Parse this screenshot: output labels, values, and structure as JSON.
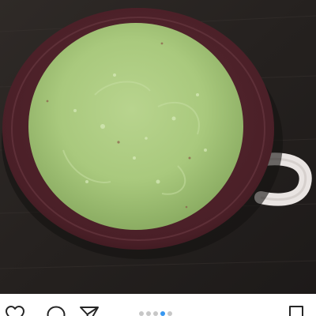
{
  "post": {
    "image": {
      "alt": "",
      "subject": "bowl-of-green-soup"
    },
    "actions": {
      "like_icon": "heart-outline-icon",
      "comment_icon": "speech-bubble-icon",
      "share_icon": "paper-plane-icon",
      "save_icon": "bookmark-outline-icon"
    },
    "carousel": {
      "total": 5,
      "active": 4,
      "active_color": "#3897f0",
      "inactive_color": "#c7c7c7"
    }
  },
  "colors": {
    "icon": "#262626",
    "background": "#ffffff"
  }
}
